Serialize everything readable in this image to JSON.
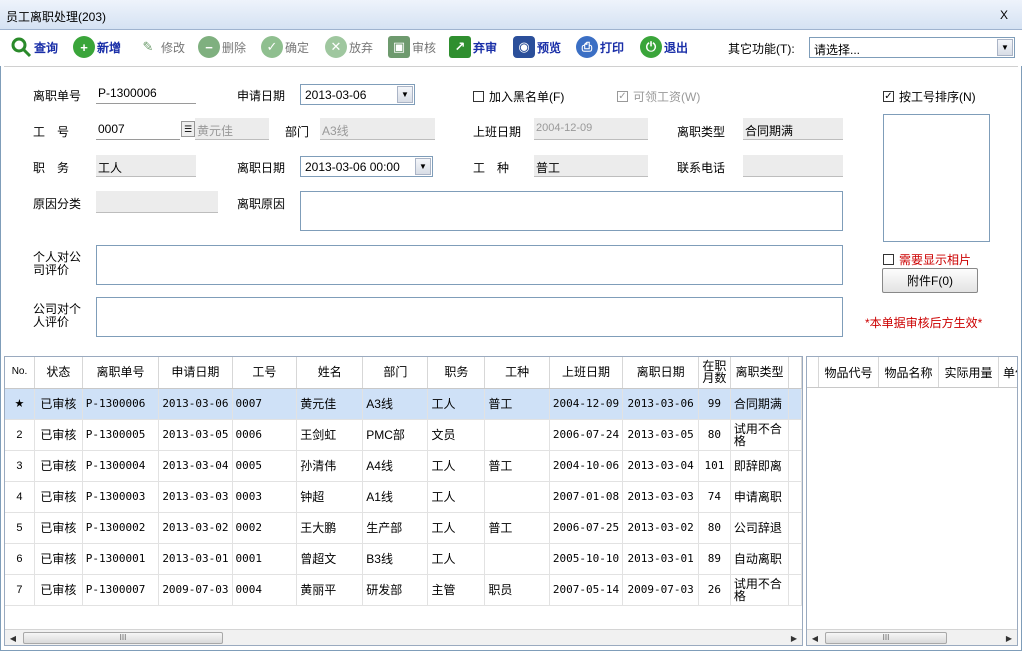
{
  "window": {
    "title": "员工离职处理(203)",
    "close_label": "X"
  },
  "toolbar": {
    "buttons": [
      {
        "label": "查询",
        "icon": "search-icon",
        "enabled": true
      },
      {
        "label": "新增",
        "icon": "add-icon",
        "enabled": true
      },
      {
        "label": "修改",
        "icon": "edit-icon",
        "enabled": false
      },
      {
        "label": "删除",
        "icon": "minus-icon",
        "enabled": false
      },
      {
        "label": "确定",
        "icon": "check-icon",
        "enabled": false
      },
      {
        "label": "放弃",
        "icon": "cancel-icon",
        "enabled": false
      },
      {
        "label": "审核",
        "icon": "audit-icon",
        "enabled": false
      },
      {
        "label": "弃审",
        "icon": "unaudit-icon",
        "enabled": true
      },
      {
        "label": "预览",
        "icon": "preview-icon",
        "enabled": true
      },
      {
        "label": "打印",
        "icon": "print-icon",
        "enabled": true
      },
      {
        "label": "退出",
        "icon": "exit-icon",
        "enabled": true
      }
    ],
    "other_label": "其它功能(T):",
    "other_value": "请选择..."
  },
  "form": {
    "labels": {
      "doc_no": "离职单号",
      "apply_date": "申请日期",
      "emp_no": "工　号",
      "dept": "部门",
      "hire_date": "上班日期",
      "leave_type": "离职类型",
      "position": "职　务",
      "leave_date": "离职日期",
      "work_type": "工　种",
      "phone": "联系电话",
      "reason_cat": "原因分类",
      "reason": "离职原因",
      "personal_eval": "个人对公司评价",
      "company_eval": "公司对个人评价"
    },
    "values": {
      "doc_no": "P-1300006",
      "apply_date": "2013-03-06",
      "emp_no": "0007",
      "emp_name": "黄元佳",
      "dept": "A3线",
      "hire_date": "2004-12-09",
      "leave_type": "合同期满",
      "position": "工人",
      "leave_date": "2013-03-06 00:00",
      "work_type": "普工",
      "phone": "",
      "reason_cat": ""
    },
    "checkboxes": {
      "blacklist": {
        "label": "加入黑名单(F)",
        "checked": false
      },
      "salary": {
        "label": "可领工资(W)",
        "checked": true
      },
      "sort_by_no": {
        "label": "按工号排序(N)",
        "checked": true
      },
      "show_photo": {
        "label": "需要显示相片",
        "checked": false
      }
    },
    "attach_button": "附件F(0)",
    "note": "*本单据审核后方生效*"
  },
  "grid": {
    "columns": [
      "No.",
      "状态",
      "离职单号",
      "申请日期",
      "工号",
      "姓名",
      "部门",
      "职务",
      "工种",
      "上班日期",
      "离职日期",
      "在职月数",
      "离职类型"
    ],
    "rows": [
      {
        "no": "★",
        "status": "已审核",
        "doc": "P-1300006",
        "apply": "2013-03-06",
        "emp": "0007",
        "name": "黄元佳",
        "dept": "A3线",
        "pos": "工人",
        "type": "普工",
        "hire": "2004-12-09",
        "leave": "2013-03-06",
        "months": "99",
        "ltype": "合同期满"
      },
      {
        "no": "2",
        "status": "已审核",
        "doc": "P-1300005",
        "apply": "2013-03-05",
        "emp": "0006",
        "name": "王剑虹",
        "dept": "PMC部",
        "pos": "文员",
        "type": "",
        "hire": "2006-07-24",
        "leave": "2013-03-05",
        "months": "80",
        "ltype": "试用不合格"
      },
      {
        "no": "3",
        "status": "已审核",
        "doc": "P-1300004",
        "apply": "2013-03-04",
        "emp": "0005",
        "name": "孙清伟",
        "dept": "A4线",
        "pos": "工人",
        "type": "普工",
        "hire": "2004-10-06",
        "leave": "2013-03-04",
        "months": "101",
        "ltype": "即辞即离"
      },
      {
        "no": "4",
        "status": "已审核",
        "doc": "P-1300003",
        "apply": "2013-03-03",
        "emp": "0003",
        "name": "钟超",
        "dept": "A1线",
        "pos": "工人",
        "type": "",
        "hire": "2007-01-08",
        "leave": "2013-03-03",
        "months": "74",
        "ltype": "申请离职"
      },
      {
        "no": "5",
        "status": "已审核",
        "doc": "P-1300002",
        "apply": "2013-03-02",
        "emp": "0002",
        "name": "王大鹏",
        "dept": "生产部",
        "pos": "工人",
        "type": "普工",
        "hire": "2006-07-25",
        "leave": "2013-03-02",
        "months": "80",
        "ltype": "公司辞退"
      },
      {
        "no": "6",
        "status": "已审核",
        "doc": "P-1300001",
        "apply": "2013-03-01",
        "emp": "0001",
        "name": "曾超文",
        "dept": "B3线",
        "pos": "工人",
        "type": "",
        "hire": "2005-10-10",
        "leave": "2013-03-01",
        "months": "89",
        "ltype": "自动离职"
      },
      {
        "no": "7",
        "status": "已审核",
        "doc": "P-1300007",
        "apply": "2009-07-03",
        "emp": "0004",
        "name": "黄丽平",
        "dept": "研发部",
        "pos": "主管",
        "type": "职员",
        "hire": "2007-05-14",
        "leave": "2009-07-03",
        "months": "26",
        "ltype": "试用不合格"
      }
    ]
  },
  "side_grid": {
    "columns": [
      "物品代号",
      "物品名称",
      "实际用量",
      "单位"
    ]
  },
  "scroll_thumb": "III"
}
